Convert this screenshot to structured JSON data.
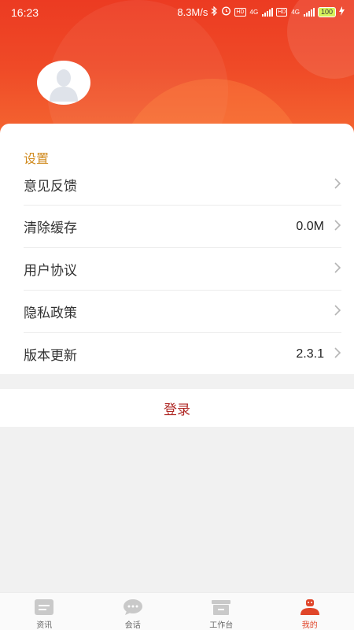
{
  "status_bar": {
    "time": "16:23",
    "speed": "8.3M/s",
    "hd1": "HD",
    "net1": "4G",
    "hd2": "HD",
    "net2": "4G",
    "battery": "100"
  },
  "profile": {
    "avatar_icon": "default-user-avatar"
  },
  "settings": {
    "section_title": "设置",
    "items": [
      {
        "label": "意见反馈",
        "value": ""
      },
      {
        "label": "清除缓存",
        "value": "0.0M"
      },
      {
        "label": "用户协议",
        "value": ""
      },
      {
        "label": "隐私政策",
        "value": ""
      },
      {
        "label": "版本更新",
        "value": "2.3.1"
      }
    ]
  },
  "login_label": "登录",
  "tabbar": {
    "tabs": [
      {
        "label": "资讯",
        "icon": "news-icon"
      },
      {
        "label": "会话",
        "icon": "chat-icon"
      },
      {
        "label": "工作台",
        "icon": "workbench-icon"
      },
      {
        "label": "我的",
        "icon": "profile-icon"
      }
    ],
    "active": "我的"
  },
  "colors": {
    "header_red": "#ec3b22",
    "section_title": "#d08a1d",
    "login_text": "#b02a27",
    "active_tab": "#e0462a"
  }
}
